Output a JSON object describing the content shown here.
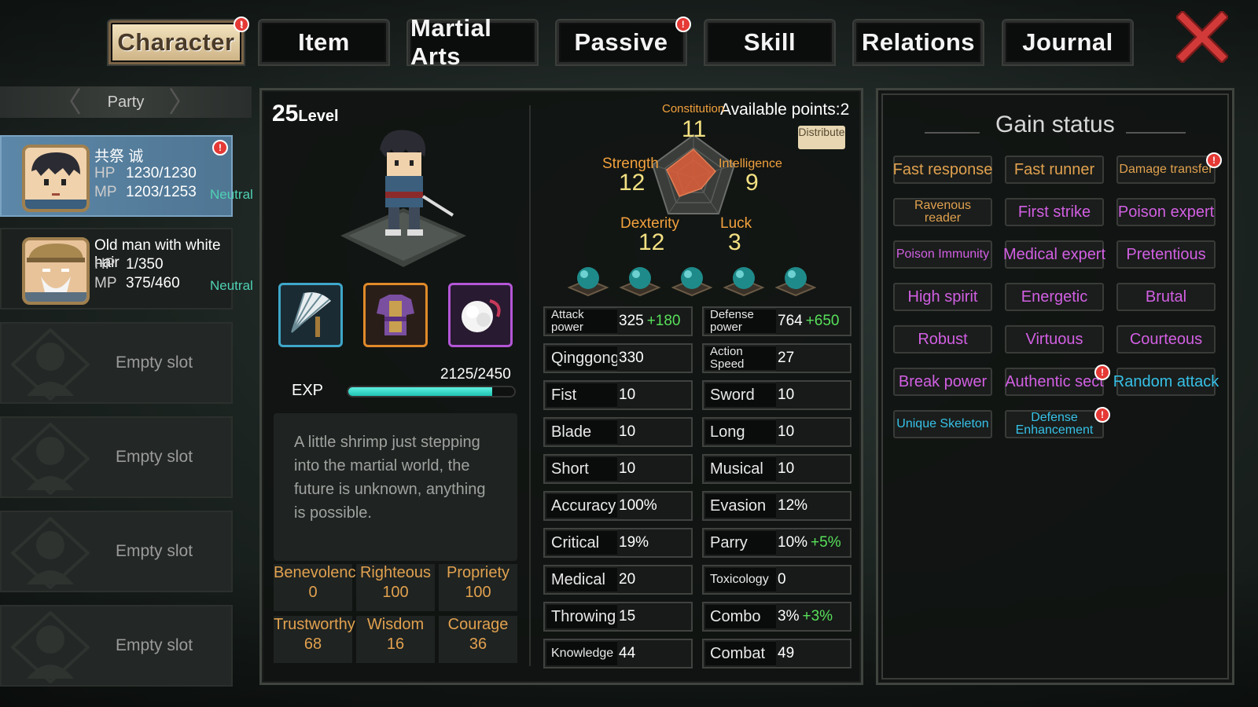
{
  "tabs": [
    {
      "label": "Character",
      "active": true,
      "alert": true
    },
    {
      "label": "Item",
      "active": false,
      "alert": false
    },
    {
      "label": "Martial Arts",
      "active": false,
      "alert": false
    },
    {
      "label": "Passive",
      "active": false,
      "alert": true
    },
    {
      "label": "Skill",
      "active": false,
      "alert": false
    },
    {
      "label": "Relations",
      "active": false,
      "alert": false
    },
    {
      "label": "Journal",
      "active": false,
      "alert": false
    }
  ],
  "party": {
    "header": "Party",
    "members": [
      {
        "name": "共祭 诚",
        "hp_label": "HP",
        "hp": "1230/1230",
        "mp_label": "MP",
        "mp": "1203/1253",
        "alignment": "Neutral",
        "alert": true,
        "selected": true
      },
      {
        "name": "Old man with white hair",
        "hp_label": "HP",
        "hp": "1/350",
        "mp_label": "MP",
        "mp": "375/460",
        "alignment": "Neutral",
        "alert": false,
        "selected": false
      }
    ],
    "empty_slots": [
      "Empty slot",
      "Empty slot",
      "Empty slot",
      "Empty slot"
    ]
  },
  "character": {
    "level_value": "25",
    "level_label": "Level",
    "exp_label": "EXP",
    "exp_text": "2125/2450",
    "exp_fraction": 0.867,
    "description": "A little shrimp just stepping into the martial world, the future is unknown, anything is possible.",
    "equipment": [
      "fan-icon",
      "armor-icon",
      "accessory-icon"
    ],
    "morals": [
      {
        "label": "Benevolence",
        "value": "0"
      },
      {
        "label": "Righteous",
        "value": "100"
      },
      {
        "label": "Propriety",
        "value": "100"
      },
      {
        "label": "Trustworthy",
        "value": "68"
      },
      {
        "label": "Wisdom",
        "value": "16"
      },
      {
        "label": "Courage",
        "value": "36"
      }
    ]
  },
  "attributes": {
    "available_label": "Available points:",
    "available_value": "2",
    "distribute_label": "Distribute",
    "constitution": {
      "label": "Constitution",
      "value": "11"
    },
    "strength": {
      "label": "Strength",
      "value": "12"
    },
    "intelligence": {
      "label": "Intelligence",
      "value": "9"
    },
    "dexterity": {
      "label": "Dexterity",
      "value": "12"
    },
    "luck": {
      "label": "Luck",
      "value": "3"
    }
  },
  "stats": [
    {
      "label": "Attack power",
      "value": "325",
      "bonus": "+180"
    },
    {
      "label": "Defense power",
      "value": "764",
      "bonus": "+650"
    },
    {
      "label": "Qinggong",
      "value": "330",
      "bonus": ""
    },
    {
      "label": "Action Speed",
      "value": "27",
      "bonus": ""
    },
    {
      "label": "Fist",
      "value": "10",
      "bonus": ""
    },
    {
      "label": "Sword",
      "value": "10",
      "bonus": ""
    },
    {
      "label": "Blade",
      "value": "10",
      "bonus": ""
    },
    {
      "label": "Long",
      "value": "10",
      "bonus": ""
    },
    {
      "label": "Short",
      "value": "10",
      "bonus": ""
    },
    {
      "label": "Musical",
      "value": "10",
      "bonus": ""
    },
    {
      "label": "Accuracy",
      "value": "100%",
      "bonus": ""
    },
    {
      "label": "Evasion",
      "value": "12%",
      "bonus": ""
    },
    {
      "label": "Critical",
      "value": "19%",
      "bonus": ""
    },
    {
      "label": "Parry",
      "value": "10%",
      "bonus": "+5%"
    },
    {
      "label": "Medical",
      "value": "20",
      "bonus": ""
    },
    {
      "label": "Toxicology",
      "value": "0",
      "bonus": ""
    },
    {
      "label": "Throwing",
      "value": "15",
      "bonus": ""
    },
    {
      "label": "Combo",
      "value": "3%",
      "bonus": "+3%"
    },
    {
      "label": "Knowledge",
      "value": "44",
      "bonus": ""
    },
    {
      "label": "Combat",
      "value": "49",
      "bonus": ""
    }
  ],
  "gain_status": {
    "title": "Gain status",
    "traits": [
      {
        "label": "Fast response",
        "color": "gold",
        "alert": false
      },
      {
        "label": "Fast runner",
        "color": "gold",
        "alert": false
      },
      {
        "label": "Damage transfer",
        "color": "gold",
        "alert": true
      },
      {
        "label": "Ravenous reader",
        "color": "gold",
        "alert": false
      },
      {
        "label": "First strike",
        "color": "pink",
        "alert": false
      },
      {
        "label": "Poison expert",
        "color": "pink",
        "alert": false
      },
      {
        "label": "Poison Immunity",
        "color": "pink",
        "alert": false
      },
      {
        "label": "Medical expert",
        "color": "pink",
        "alert": false
      },
      {
        "label": "Pretentious",
        "color": "pink",
        "alert": false
      },
      {
        "label": "High spirit",
        "color": "pink",
        "alert": false
      },
      {
        "label": "Energetic",
        "color": "pink",
        "alert": false
      },
      {
        "label": "Brutal",
        "color": "pink",
        "alert": false
      },
      {
        "label": "Robust",
        "color": "pink",
        "alert": false
      },
      {
        "label": "Virtuous",
        "color": "pink",
        "alert": false
      },
      {
        "label": "Courteous",
        "color": "pink",
        "alert": false
      },
      {
        "label": "Break power",
        "color": "pink",
        "alert": false
      },
      {
        "label": "Authentic sect",
        "color": "pink",
        "alert": true
      },
      {
        "label": "Random attack",
        "color": "cyan",
        "alert": false
      },
      {
        "label": "Unique Skeleton",
        "color": "cyan",
        "alert": false
      },
      {
        "label": "Defense Enhancement",
        "color": "cyan",
        "alert": true
      }
    ]
  },
  "colors": {
    "gold": "#e1a14f",
    "pink": "#d25fe3",
    "cyan": "#37c1e8",
    "accent_teal": "#1fc3b3",
    "bonus_green": "#58e05a",
    "alert_red": "#e53935"
  }
}
